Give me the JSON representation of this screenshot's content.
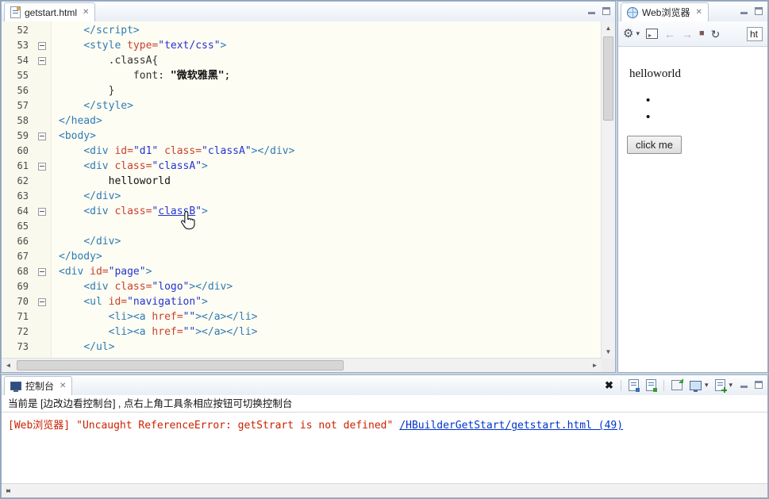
{
  "colors": {
    "tag": "#2E7BB5",
    "attr": "#C8402E",
    "string": "#2433D0",
    "error_text": "#CC2200",
    "link": "#0033CC"
  },
  "editor": {
    "tab_title": "getstart.html",
    "close_label": "✕",
    "lines": [
      {
        "n": 52,
        "ind": 1,
        "fold": false,
        "toks": [
          [
            "t",
            "</script>"
          ]
        ]
      },
      {
        "n": 53,
        "ind": 1,
        "fold": true,
        "toks": [
          [
            "t",
            "<style "
          ],
          [
            "a",
            "type="
          ],
          [
            "s",
            "\"text/css\""
          ],
          [
            "t",
            ">"
          ]
        ]
      },
      {
        "n": 54,
        "ind": 2,
        "fold": true,
        "toks": [
          [
            "c",
            ".classA{"
          ]
        ]
      },
      {
        "n": 55,
        "ind": 3,
        "fold": false,
        "toks": [
          [
            "c",
            "font: "
          ],
          [
            "zh",
            "\"微软雅黑\""
          ],
          [
            "p",
            ";"
          ]
        ]
      },
      {
        "n": 56,
        "ind": 2,
        "fold": false,
        "toks": [
          [
            "c",
            "}"
          ]
        ]
      },
      {
        "n": 57,
        "ind": 1,
        "fold": false,
        "toks": [
          [
            "t",
            "</style>"
          ]
        ]
      },
      {
        "n": 58,
        "ind": 0,
        "fold": false,
        "toks": [
          [
            "t",
            "</head>"
          ]
        ]
      },
      {
        "n": 59,
        "ind": 0,
        "fold": true,
        "toks": [
          [
            "t",
            "<body>"
          ]
        ]
      },
      {
        "n": 60,
        "ind": 1,
        "fold": false,
        "toks": [
          [
            "t",
            "<div "
          ],
          [
            "a",
            "id="
          ],
          [
            "s",
            "\"d1\""
          ],
          [
            "p",
            " "
          ],
          [
            "a",
            "class="
          ],
          [
            "s",
            "\"classA\""
          ],
          [
            "t",
            "></div>"
          ]
        ]
      },
      {
        "n": 61,
        "ind": 1,
        "fold": true,
        "toks": [
          [
            "t",
            "<div "
          ],
          [
            "a",
            "class="
          ],
          [
            "s",
            "\"classA\""
          ],
          [
            "t",
            ">"
          ]
        ]
      },
      {
        "n": 62,
        "ind": 2,
        "fold": false,
        "toks": [
          [
            "p",
            "helloworld"
          ]
        ]
      },
      {
        "n": 63,
        "ind": 1,
        "fold": false,
        "toks": [
          [
            "t",
            "</div>"
          ]
        ]
      },
      {
        "n": 64,
        "ind": 1,
        "fold": true,
        "toks": [
          [
            "t",
            "<div "
          ],
          [
            "a",
            "class="
          ],
          [
            "s",
            "\""
          ],
          [
            "su",
            "classB"
          ],
          [
            "s",
            "\""
          ],
          [
            "t",
            ">"
          ]
        ]
      },
      {
        "n": 65,
        "ind": 0,
        "fold": false,
        "toks": []
      },
      {
        "n": 66,
        "ind": 1,
        "fold": false,
        "toks": [
          [
            "t",
            "</div>"
          ]
        ]
      },
      {
        "n": 67,
        "ind": 0,
        "fold": false,
        "toks": [
          [
            "t",
            "</body>"
          ]
        ]
      },
      {
        "n": 68,
        "ind": 0,
        "fold": true,
        "toks": [
          [
            "t",
            "<div "
          ],
          [
            "a",
            "id="
          ],
          [
            "s",
            "\"page\""
          ],
          [
            "t",
            ">"
          ]
        ]
      },
      {
        "n": 69,
        "ind": 1,
        "fold": false,
        "toks": [
          [
            "t",
            "<div "
          ],
          [
            "a",
            "class="
          ],
          [
            "s",
            "\"logo\""
          ],
          [
            "t",
            "></div>"
          ]
        ]
      },
      {
        "n": 70,
        "ind": 1,
        "fold": true,
        "toks": [
          [
            "t",
            "<ul "
          ],
          [
            "a",
            "id="
          ],
          [
            "s",
            "\"navigation\""
          ],
          [
            "t",
            ">"
          ]
        ]
      },
      {
        "n": 71,
        "ind": 2,
        "fold": false,
        "toks": [
          [
            "t",
            "<li><a "
          ],
          [
            "a",
            "href="
          ],
          [
            "s",
            "\"\""
          ],
          [
            "t",
            "></a></li>"
          ]
        ]
      },
      {
        "n": 72,
        "ind": 2,
        "fold": false,
        "toks": [
          [
            "t",
            "<li><a "
          ],
          [
            "a",
            "href="
          ],
          [
            "s",
            "\"\""
          ],
          [
            "t",
            "></a></li>"
          ]
        ]
      },
      {
        "n": 73,
        "ind": 1,
        "fold": false,
        "toks": [
          [
            "t",
            "</ul>"
          ]
        ]
      }
    ],
    "scrollbar": {
      "up": "▲",
      "down": "▼",
      "left": "◄",
      "right": "►"
    }
  },
  "browser": {
    "tab_title": "Web浏览器",
    "close_label": "✕",
    "toolbar": {
      "gear": "⚙",
      "caret": "▾",
      "term_glyph": "▸",
      "back": "←",
      "forward": "→",
      "stop": "■",
      "refresh": "↻",
      "url_value": "ht"
    },
    "content": {
      "heading": "helloworld",
      "bullets": [
        "•",
        "•"
      ],
      "button_label": "click me"
    }
  },
  "console": {
    "tab_title": "控制台",
    "close_label": "✕",
    "clear_label": "✖",
    "caret": "▾",
    "info_text": "当前是 [边改边看控制台] , 点右上角工具条相应按钮可切换控制台",
    "error_source": "[Web浏览器]",
    "error_text": "\"Uncaught ReferenceError: getStrart is not defined\"",
    "error_link": "/HBuilderGetStart/getstart.html (49)",
    "scrollbar": {
      "left": "◄",
      "right": "►"
    }
  }
}
